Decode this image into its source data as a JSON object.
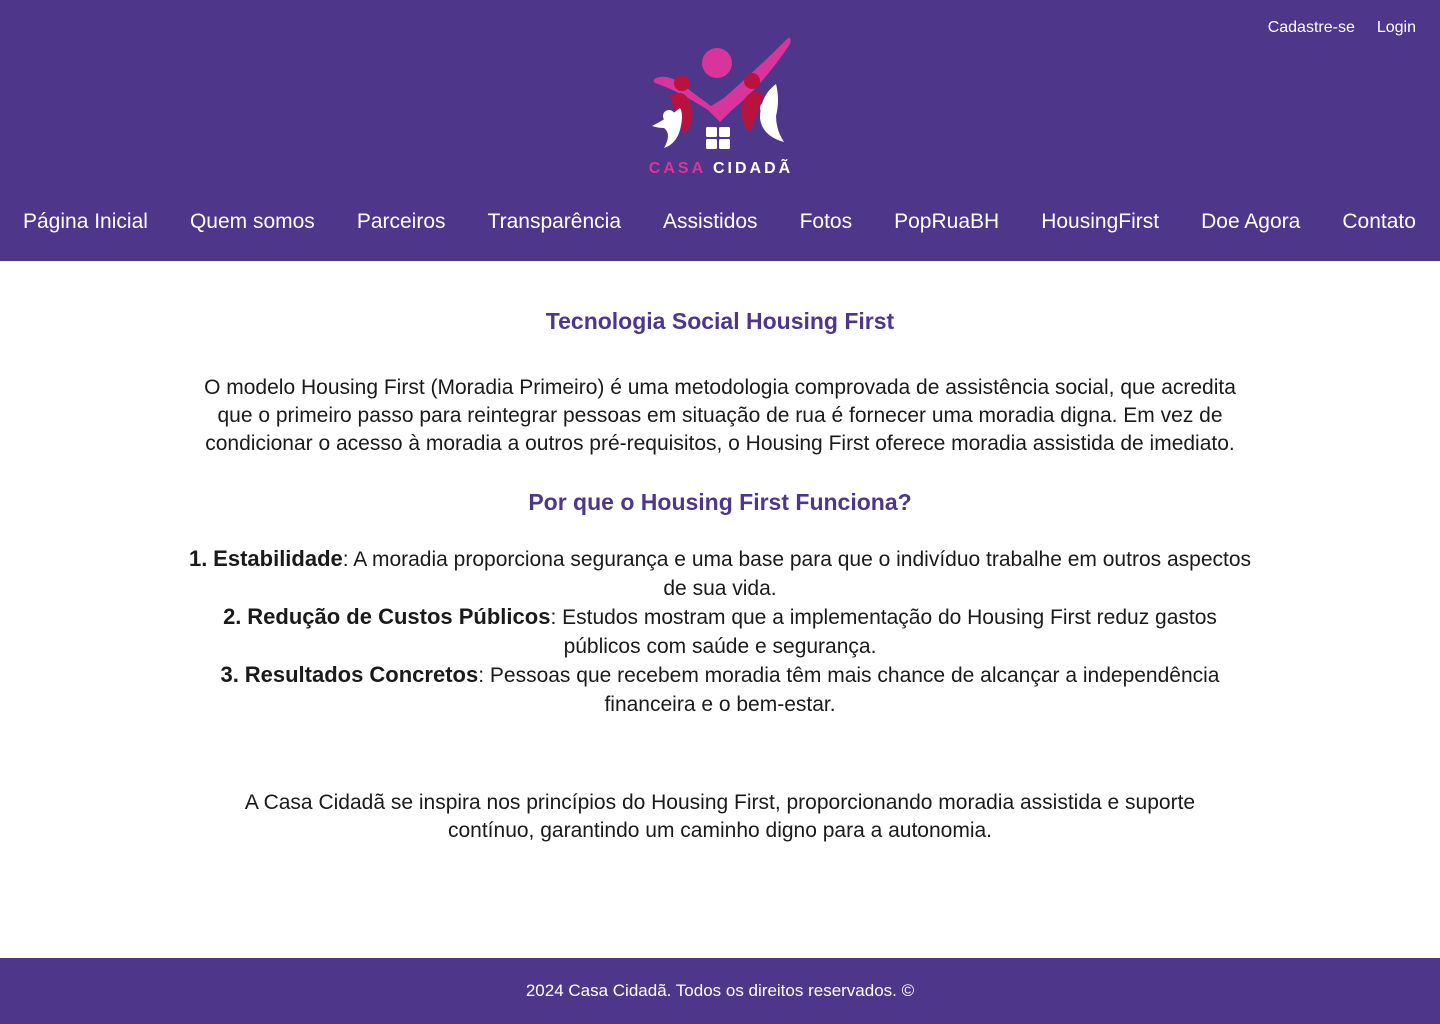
{
  "header": {
    "auth": {
      "signup": "Cadastre-se",
      "login": "Login"
    },
    "logo": {
      "word1": "CASA",
      "word2": "CIDADÃ"
    },
    "nav": [
      "Página Inicial",
      "Quem somos",
      "Parceiros",
      "Transparência",
      "Assistidos",
      "Fotos",
      "PopRuaBH",
      "HousingFirst",
      "Doe Agora",
      "Contato"
    ]
  },
  "main": {
    "title": "Tecnologia Social Housing First",
    "intro": "O modelo Housing First (Moradia Primeiro) é uma metodologia comprovada de assistência social, que acredita que o primeiro passo para reintegrar pessoas em situação de rua é fornecer uma moradia digna. Em vez de condicionar o acesso à moradia a outros pré-requisitos, o Housing First oferece moradia assistida de imediato.",
    "subtitle": "Por que o Housing First Funciona?",
    "reasons": [
      {
        "number": "1.",
        "heading": "Estabilidade",
        "text": ": A moradia proporciona segurança e uma base para que o indivíduo trabalhe em outros aspectos de sua vida."
      },
      {
        "number": "2.",
        "heading": "Redução de Custos Públicos",
        "text": ": Estudos mostram que a implementação do Housing First reduz gastos públicos com saúde e segurança."
      },
      {
        "number": "3.",
        "heading": "Resultados Concretos",
        "text": ": Pessoas que recebem moradia têm mais chance de alcançar a independência financeira e o bem-estar."
      }
    ],
    "closing": "A Casa Cidadã se inspira nos princípios do Housing First, proporcionando moradia assistida e suporte contínuo, garantindo um caminho digno para a autonomia."
  },
  "footer": {
    "text": "2024 Casa Cidadã. Todos os direitos reservados. ©"
  },
  "colors": {
    "brand_purple": "#4e368b",
    "logo_pink": "#d7359c",
    "logo_red": "#b8123f"
  }
}
